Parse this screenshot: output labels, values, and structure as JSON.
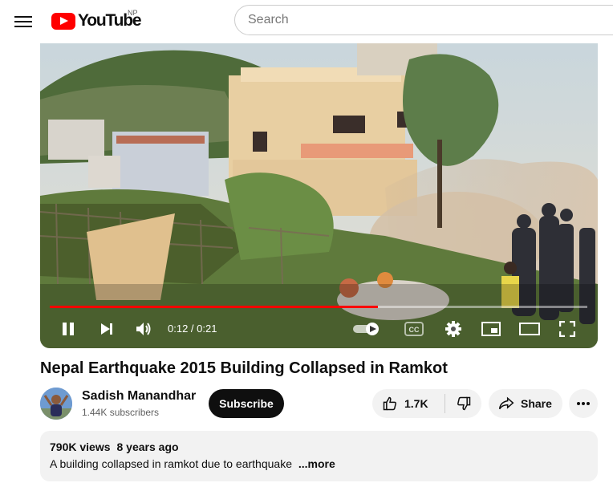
{
  "header": {
    "logo_text": "YouTube",
    "country_code": "NP",
    "search_placeholder": "Search"
  },
  "player": {
    "current_time": "0:12",
    "duration": "0:21",
    "time_display": "0:12 / 0:21",
    "progress_fraction": 0.61,
    "icons": [
      "pause-icon",
      "next-icon",
      "volume-icon",
      "autoplay-toggle-icon",
      "captions-icon",
      "settings-icon",
      "miniplayer-icon",
      "theater-mode-icon",
      "fullscreen-icon"
    ],
    "captions_label": "CC",
    "accent_color": "#ff0000"
  },
  "video": {
    "title": "Nepal Earthquake 2015 Building Collapsed in Ramkot"
  },
  "channel": {
    "name": "Sadish Manandhar",
    "subscribers": "1.44K subscribers",
    "subscribe_label": "Subscribe"
  },
  "actions": {
    "like_count": "1.7K",
    "share_label": "Share",
    "more_icon": "more-horizontal-icon"
  },
  "description": {
    "views": "790K views",
    "age": "8 years ago",
    "text": "A building collapsed in ramkot due to earthquake",
    "more_label": "...more"
  }
}
